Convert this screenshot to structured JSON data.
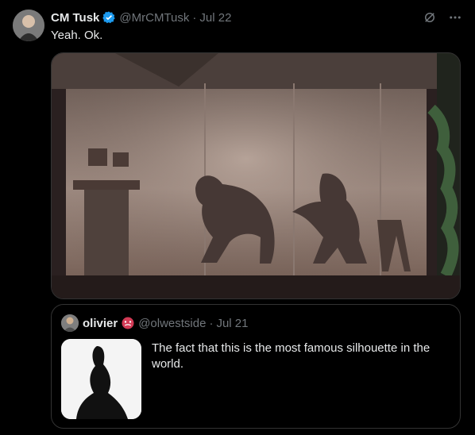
{
  "tweet": {
    "author_name": "CM Tusk",
    "handle": "@MrCMTusk",
    "separator": "·",
    "date": "Jul 22",
    "text": "Yeah. Ok."
  },
  "quote": {
    "author_name": "olivier",
    "handle": "@olwestside",
    "separator": "·",
    "date": "Jul 21",
    "text": "The fact that this is the most famous silhouette in the world."
  },
  "icons": {
    "verified": "verified-badge-icon",
    "grok": "grok-icon",
    "more": "more-icon",
    "emoji": "face-emoji-icon"
  },
  "colors": {
    "background": "#000000",
    "text": "#e7e9ea",
    "muted": "#71767b",
    "verified": "#1d9bf0",
    "border": "#333333"
  }
}
